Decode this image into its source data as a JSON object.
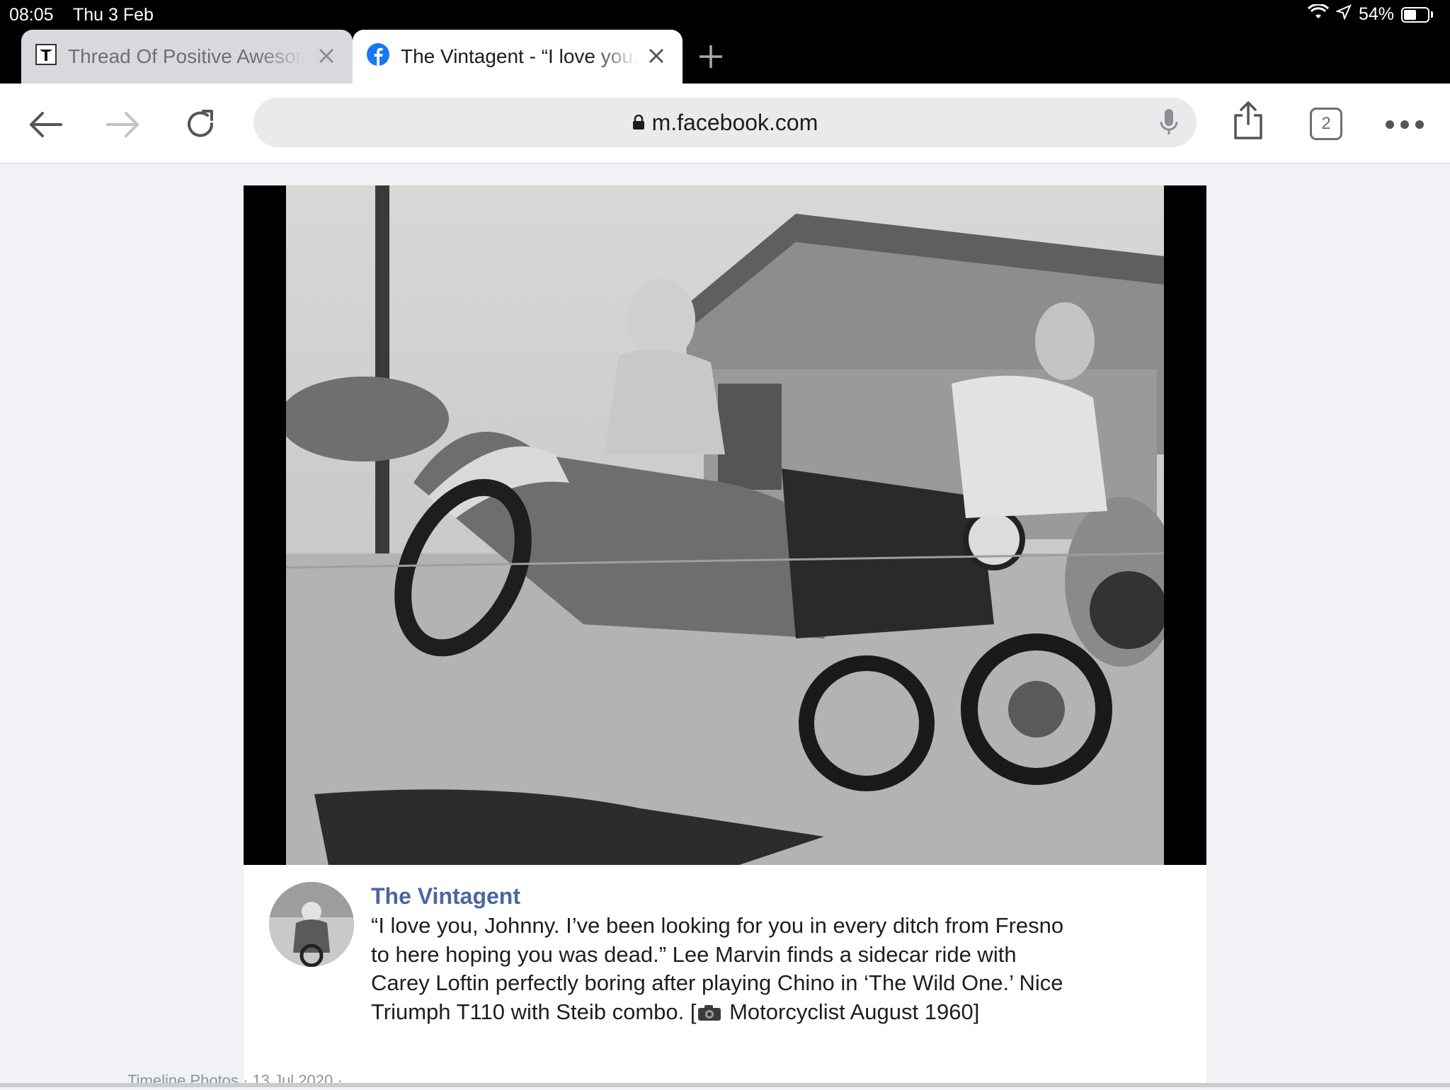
{
  "status": {
    "time": "08:05",
    "date": "Thu 3 Feb",
    "battery_text": "54%",
    "battery_level": 0.54
  },
  "tabs": [
    {
      "title": "Thread Of Positive Awesome",
      "favicon": "triumph-logo-icon",
      "active": false
    },
    {
      "title": "The Vintagent - “I love you, Johnny”",
      "favicon": "facebook-icon",
      "active": true
    }
  ],
  "toolbar": {
    "url": "m.facebook.com",
    "tab_count": "2"
  },
  "post": {
    "page_name": "The Vintagent",
    "text_before_icon": "“I love you, Johnny. I’ve been looking for you in every ditch from Fresno to here hoping you was dead.” Lee Marvin finds a sidecar ride with Carey Loftin perfectly boring after playing Chino in ‘The Wild One.’ Nice Triumph T110 with Steib combo. [",
    "text_after_icon": " Motorcyclist August 1960]",
    "meta": "Timeline Photos · 13 Jul 2020 ·"
  },
  "colors": {
    "page_name": "#4b67a1",
    "facebook_blue": "#1877f2"
  }
}
